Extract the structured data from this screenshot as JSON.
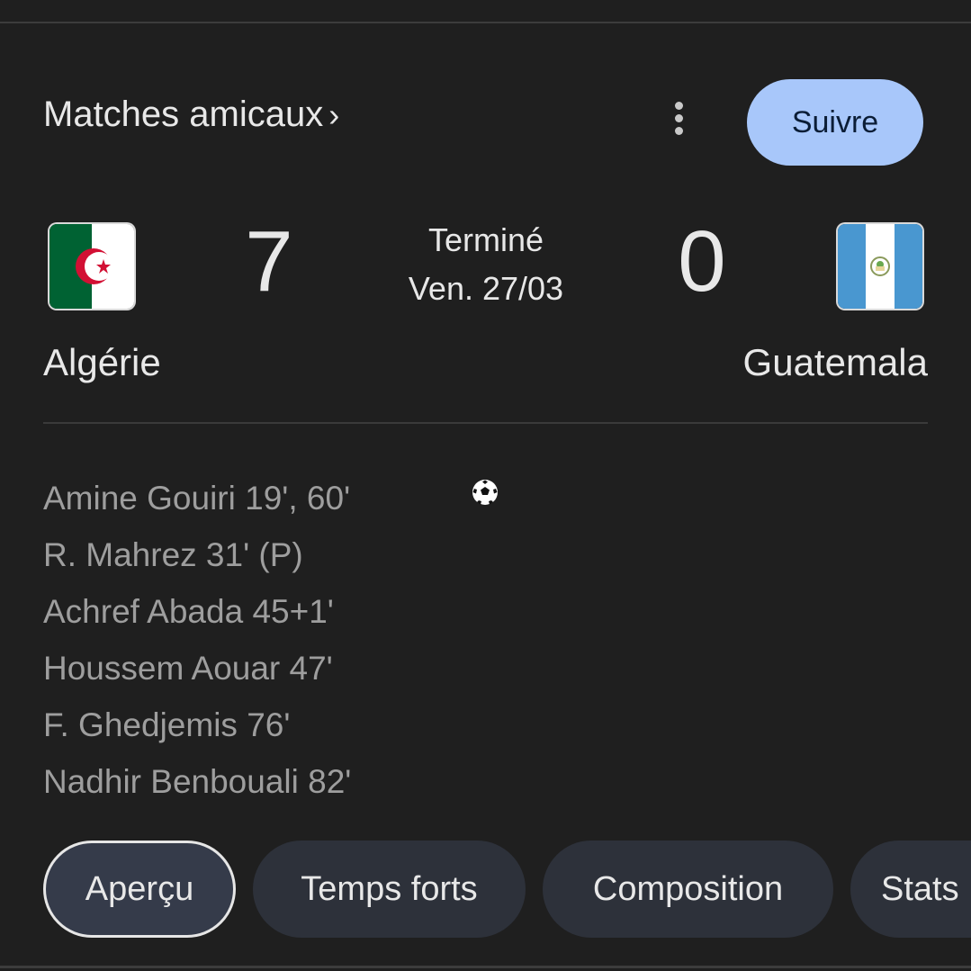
{
  "header": {
    "league_label": "Matches amicaux",
    "league_chevron": "›",
    "more_icon": "more-vertical-icon",
    "follow_label": "Suivre"
  },
  "match": {
    "status": "Terminé",
    "date": "Ven. 27/03",
    "home": {
      "name": "Algérie",
      "score": "7",
      "flag": "algeria-flag",
      "flag_colors": {
        "green": "#006233",
        "white": "#ffffff",
        "red": "#d21034"
      }
    },
    "away": {
      "name": "Guatemala",
      "score": "0",
      "flag": "guatemala-flag",
      "flag_colors": {
        "blue": "#4997d0",
        "white": "#ffffff"
      }
    }
  },
  "scorers": [
    "Amine Gouiri 19', 60'",
    "R. Mahrez 31' (P)",
    "Achref Abada 45+1'",
    "Houssem Aouar 47'",
    "F. Ghedjemis 76'",
    "Nadhir Benbouali 82'"
  ],
  "goal_icon": "soccer-ball-icon",
  "tabs": [
    {
      "label": "Aperçu",
      "active": true
    },
    {
      "label": "Temps forts",
      "active": false
    },
    {
      "label": "Composition",
      "active": false
    },
    {
      "label": "Stats",
      "active": false
    }
  ],
  "colors": {
    "background": "#1f1f1f",
    "follow_button": "#a8c7fa",
    "tab_background": "#2d313a",
    "scorer_text": "#9e9e9e"
  }
}
